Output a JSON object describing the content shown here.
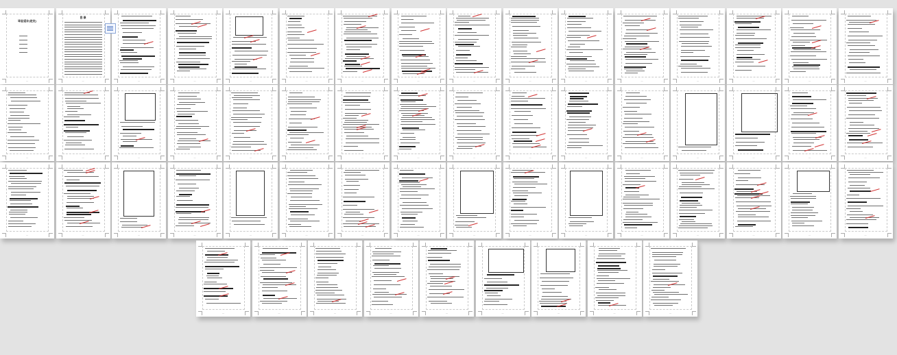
{
  "document": {
    "cover_title": "毕业设计(论文)",
    "toc_title": "目 录"
  },
  "view": {
    "layout": "multi-page thumbnail view",
    "background": "#e3e3e3",
    "page_rows": [
      16,
      16,
      16,
      9
    ]
  },
  "pages": [
    {
      "kind": "cover"
    },
    {
      "kind": "toc"
    },
    {
      "kind": "text"
    },
    {
      "kind": "text"
    },
    {
      "kind": "figure"
    },
    {
      "kind": "text"
    },
    {
      "kind": "text"
    },
    {
      "kind": "text"
    },
    {
      "kind": "text"
    },
    {
      "kind": "text"
    },
    {
      "kind": "text"
    },
    {
      "kind": "text"
    },
    {
      "kind": "text"
    },
    {
      "kind": "text"
    },
    {
      "kind": "text"
    },
    {
      "kind": "text"
    },
    {
      "kind": "text"
    },
    {
      "kind": "text"
    },
    {
      "kind": "figure"
    },
    {
      "kind": "text"
    },
    {
      "kind": "text"
    },
    {
      "kind": "text"
    },
    {
      "kind": "text"
    },
    {
      "kind": "text"
    },
    {
      "kind": "text"
    },
    {
      "kind": "text"
    },
    {
      "kind": "text"
    },
    {
      "kind": "text"
    },
    {
      "kind": "figure"
    },
    {
      "kind": "figure"
    },
    {
      "kind": "text"
    },
    {
      "kind": "text"
    },
    {
      "kind": "text"
    },
    {
      "kind": "text"
    },
    {
      "kind": "figure"
    },
    {
      "kind": "text"
    },
    {
      "kind": "figure"
    },
    {
      "kind": "text"
    },
    {
      "kind": "text"
    },
    {
      "kind": "text"
    },
    {
      "kind": "figure"
    },
    {
      "kind": "text"
    },
    {
      "kind": "figure"
    },
    {
      "kind": "text"
    },
    {
      "kind": "text"
    },
    {
      "kind": "text"
    },
    {
      "kind": "figure"
    },
    {
      "kind": "text"
    },
    {
      "kind": "text"
    },
    {
      "kind": "text"
    },
    {
      "kind": "text"
    },
    {
      "kind": "text"
    },
    {
      "kind": "text"
    },
    {
      "kind": "figure"
    },
    {
      "kind": "figure"
    },
    {
      "kind": "text"
    },
    {
      "kind": "text"
    }
  ]
}
